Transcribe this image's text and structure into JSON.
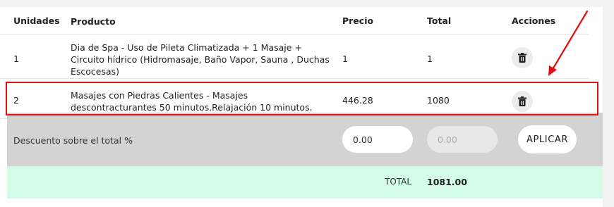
{
  "table": {
    "headers": {
      "unidades": "Unidades",
      "producto": "Producto",
      "precio": "Precio",
      "total": "Total",
      "acciones": "Acciones"
    },
    "rows": [
      {
        "unidades": "1",
        "producto": "Dia de Spa - Uso de Pileta Climatizada + 1 Masaje + Circuito hídrico (Hidromasaje, Baño Vapor, Sauna , Duchas Escocesas)",
        "precio": "1",
        "total": "1",
        "action_icon": "trash-icon"
      },
      {
        "unidades": "2",
        "producto": "Masajes con Piedras Calientes - Masajes descontracturantes 50 minutos.Relajación 10 minutos.",
        "precio": "446.28",
        "total": "1080",
        "action_icon": "trash-icon"
      }
    ]
  },
  "discount": {
    "label": "Descuento sobre el total %",
    "percent_value": "0.00",
    "amount_placeholder": "0.00",
    "apply_label": "APLICAR"
  },
  "summary": {
    "total_label": "TOTAL",
    "total_value": "1081.00"
  },
  "annotation": {
    "highlight_color": "#e01010",
    "arrow_color": "#e01010"
  },
  "colors": {
    "discount_bg": "#d3d3d3",
    "total_bg": "#d4fbe8"
  }
}
